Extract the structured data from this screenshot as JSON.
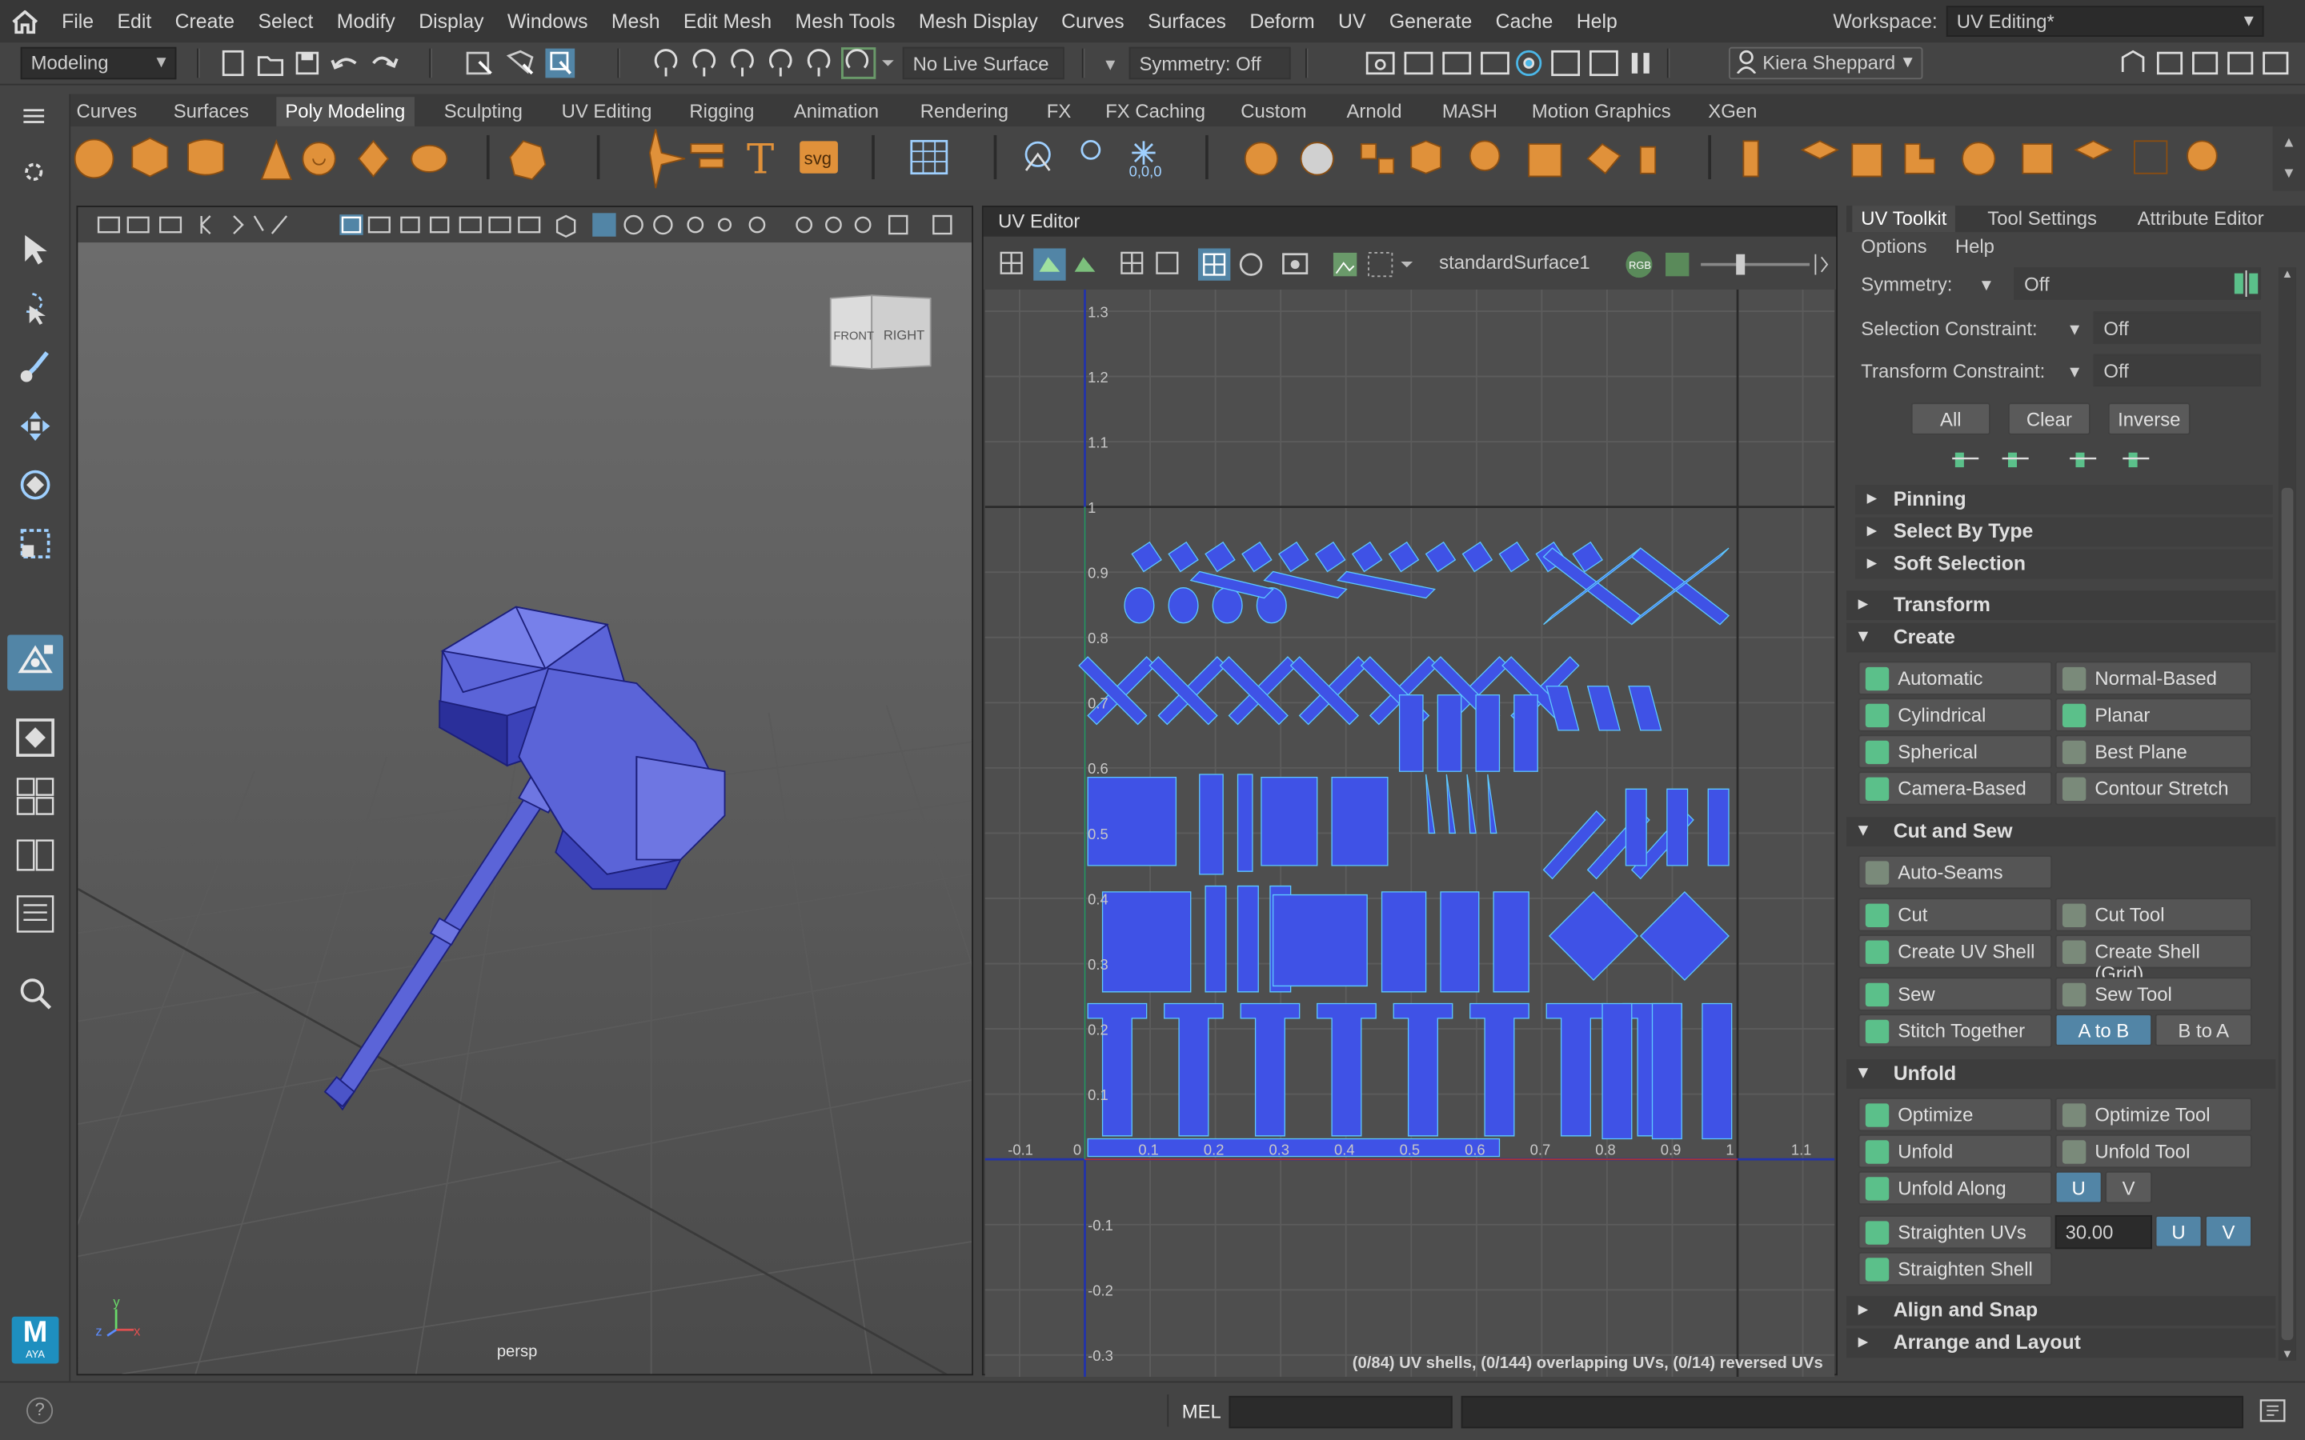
{
  "menubar": {
    "items": [
      "File",
      "Edit",
      "Create",
      "Select",
      "Modify",
      "Display",
      "Windows",
      "Mesh",
      "Edit Mesh",
      "Mesh Tools",
      "Mesh Display",
      "Curves",
      "Surfaces",
      "Deform",
      "UV",
      "Generate",
      "Cache",
      "Help"
    ],
    "workspace_label": "Workspace:",
    "workspace_value": "UV Editing*"
  },
  "statusline": {
    "mode": "Modeling",
    "live_surface": "No Live Surface",
    "symmetry": "Symmetry: Off",
    "user": "Kiera Sheppard"
  },
  "shelf": {
    "tabs": [
      "Curves",
      "Surfaces",
      "Poly Modeling",
      "Sculpting",
      "UV Editing",
      "Rigging",
      "Animation",
      "Rendering",
      "FX",
      "FX Caching",
      "Custom",
      "Arnold",
      "MASH",
      "Motion Graphics",
      "XGen"
    ],
    "active_tab": "Poly Modeling",
    "text_tool": "T",
    "svg_tool": "svg",
    "pivot_readout": "0,0,0"
  },
  "viewport": {
    "camera": "persp",
    "viewcube_front": "FRONT",
    "viewcube_right": "RIGHT",
    "axis_x": "x",
    "axis_y": "y",
    "axis_z": "z",
    "logo_letter": "M",
    "logo_text": "AYA"
  },
  "uv_editor": {
    "title": "UV Editor",
    "shader": "standardSurface1",
    "rgb_label": "RGB",
    "status": "(0/84) UV shells, (0/144) overlapping UVs, (0/14) reversed UVs",
    "v_ticks": [
      "1.3",
      "1.2",
      "1.1",
      "1",
      "0.9",
      "0.8",
      "0.7",
      "0.6",
      "0.5",
      "0.4",
      "0.3",
      "0.2",
      "0.1",
      "-0.1",
      "-0.2",
      "-0.3"
    ],
    "u_ticks": [
      "-0.1",
      "0",
      "0.1",
      "0.2",
      "0.3",
      "0.4",
      "0.5",
      "0.6",
      "0.7",
      "0.8",
      "0.9",
      "1",
      "1.1"
    ]
  },
  "uv_toolkit": {
    "tabs": [
      "UV Toolkit",
      "Tool Settings",
      "Attribute Editor"
    ],
    "menu": [
      "Options",
      "Help"
    ],
    "symmetry_label": "Symmetry:",
    "symmetry_value": "Off",
    "selection_constraint_label": "Selection Constraint:",
    "selection_constraint_value": "Off",
    "transform_constraint_label": "Transform Constraint:",
    "transform_constraint_value": "Off",
    "select_buttons": [
      "All",
      "Clear",
      "Inverse"
    ],
    "collapsed_subsections": [
      "Pinning",
      "Select By Type",
      "Soft Selection"
    ],
    "transform_section": "Transform",
    "create_section": "Create",
    "create_buttons": [
      "Automatic",
      "Normal-Based",
      "Cylindrical",
      "Planar",
      "Spherical",
      "Best Plane",
      "Camera-Based",
      "Contour Stretch"
    ],
    "cut_sew_section": "Cut and Sew",
    "cut_sew_buttons": {
      "auto_seams": "Auto-Seams",
      "cut": "Cut",
      "cut_tool": "Cut Tool",
      "create_uv_shell": "Create UV Shell",
      "create_shell_grid": "Create Shell (Grid)",
      "sew": "Sew",
      "sew_tool": "Sew Tool",
      "stitch_together": "Stitch Together",
      "a_to_b": "A to B",
      "b_to_a": "B to A"
    },
    "unfold_section": "Unfold",
    "unfold_buttons": {
      "optimize": "Optimize",
      "optimize_tool": "Optimize Tool",
      "unfold": "Unfold",
      "unfold_tool": "Unfold Tool",
      "unfold_along": "Unfold Along",
      "u": "U",
      "v": "V",
      "straighten_uvs": "Straighten UVs",
      "straighten_value": "30.00",
      "straighten_shell": "Straighten Shell"
    },
    "align_snap_section": "Align and Snap",
    "arrange_layout_section": "Arrange and Layout"
  },
  "command_line": {
    "language": "MEL",
    "help": "?"
  },
  "colors": {
    "accent_blue": "#5285a6",
    "uv_shell_fill": "#3f52e6",
    "mesh_blue": "#5b64d8",
    "shelf_orange": "#e0913a"
  }
}
